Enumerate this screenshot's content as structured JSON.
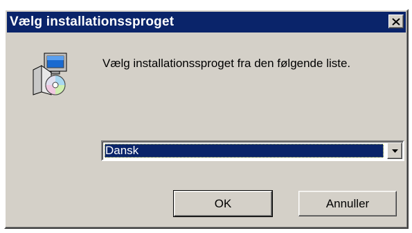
{
  "window": {
    "title": "Vælg installationssproget",
    "close_symbol": "✕"
  },
  "dialog": {
    "icon": "installer-computer-cd-icon",
    "message": "Vælg installationssproget fra den følgende liste.",
    "language_select": {
      "selected": "Dansk",
      "arrow_icon": "chevron-down-icon"
    },
    "buttons": {
      "ok_label": "OK",
      "cancel_label": "Annuller"
    }
  },
  "colors": {
    "titlebar": "#0a246a",
    "face": "#d4d0c8",
    "selection": "#0a246a"
  }
}
